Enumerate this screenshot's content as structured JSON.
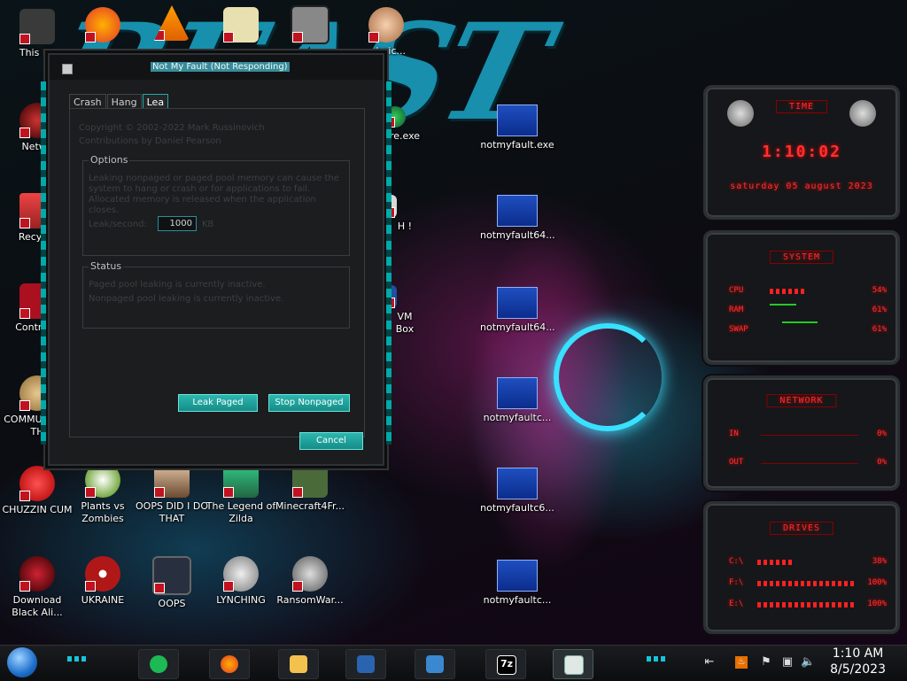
{
  "window": {
    "title": "Not My Fault (Not Responding)",
    "tabs": [
      {
        "label": "Crash"
      },
      {
        "label": "Hang"
      },
      {
        "label": "Lea"
      }
    ],
    "copyright": "Copyright © 2002-2022 Mark Russinovich",
    "contributions": "Contributions by Daniel Pearson",
    "options": {
      "label": "Options",
      "description": "Leaking nonpaged or paged pool memory can cause the system to hang or crash or for applications to fail. Allocated memory is released when the application closes.",
      "leak_label": "Leak/second:",
      "leak_value": "1000",
      "leak_unit": "KB"
    },
    "status": {
      "label": "Status",
      "line1": "Paged pool leaking is currently inactive.",
      "line2": "Nonpaged pool leaking is currently inactive."
    },
    "buttons": {
      "leak_paged": "Leak Paged",
      "stop_nonpaged": "Stop Nonpaged",
      "cancel": "Cancel"
    }
  },
  "desktop_icons": [
    {
      "label": "This PC",
      "color": "#3a3a3a"
    },
    {
      "label": "",
      "color": "#ff7a00"
    },
    {
      "label": "",
      "color": "#ff8c00"
    },
    {
      "label": "",
      "color": "#e8e0b0"
    },
    {
      "label": "",
      "color": "#888888"
    },
    {
      "label": "...hnic...",
      "color": "#e6b08a"
    },
    {
      "label": "Netwo",
      "color": "#5a1020"
    },
    {
      "label": "Recycle",
      "color": "#c03030"
    },
    {
      "label": "Control F",
      "color": "#aa1020"
    },
    {
      "label": "COMMU HATE TH",
      "color": "#c8a060"
    },
    {
      "label": "CHUZZIN CUM",
      "color": "#d02020"
    },
    {
      "label": "Plants vs Zombies",
      "color": "#70a040"
    },
    {
      "label": "OOPS DID I DO THAT",
      "color": "#d0b090"
    },
    {
      "label": "The Legend of Zilda",
      "color": "#40a070"
    },
    {
      "label": "Minecraft4Fr...",
      "color": "#4a6a3a"
    },
    {
      "label": "Download Black Ali...",
      "color": "#600010"
    },
    {
      "label": "UKRAINE",
      "color": "#b01818"
    },
    {
      "label": "OOPS",
      "color": "#283040"
    },
    {
      "label": "LYNCHING",
      "color": "#c8c8c8"
    },
    {
      "label": "RansomWar...",
      "color": "#aaaaaa"
    },
    {
      "label": "re.exe",
      "color": "#2aa040"
    },
    {
      "label": "H !",
      "color": "#d8d8d8"
    },
    {
      "label": "VM Box",
      "color": "#2050a0"
    }
  ],
  "bsod_icons": [
    {
      "label": "notmyfault.exe"
    },
    {
      "label": "notmyfault64..."
    },
    {
      "label": "notmyfault64..."
    },
    {
      "label": "notmyfaultc..."
    },
    {
      "label": "notmyfaultc6..."
    },
    {
      "label": "notmyfaultc..."
    }
  ],
  "widget": {
    "time_title": "TIME",
    "time": "1:10:02",
    "date": "saturday 05 august 2023",
    "system_title": "SYSTEM",
    "cpu_label": "CPU",
    "cpu_value": "54%",
    "cpu_level": 0.54,
    "ram_label": "RAM",
    "ram_value": "61%",
    "ram_level": 0.61,
    "swap_label": "SWAP",
    "swap_value": "61%",
    "swap_level": 0.61,
    "network_title": "NETWORK",
    "in_label": "IN",
    "in_value": "0%",
    "out_label": "OUT",
    "out_value": "0%",
    "drives_title": "DRIVES",
    "drives": [
      {
        "label": "C:\\",
        "value": "38%",
        "level": 0.38
      },
      {
        "label": "F:\\",
        "value": "100%",
        "level": 1.0
      },
      {
        "label": "E:\\",
        "value": "100%",
        "level": 1.0
      }
    ]
  },
  "taskbar": {
    "apps": [
      {
        "name": "spotify",
        "color": "#1db954"
      },
      {
        "name": "firefox",
        "color": "#ff7139"
      },
      {
        "name": "explorer",
        "color": "#f2c14e"
      },
      {
        "name": "virtualbox",
        "color": "#2a64b0"
      },
      {
        "name": "xp",
        "color": "#3a88d0"
      },
      {
        "name": "7zip",
        "color": "#000000"
      },
      {
        "name": "notmyfault",
        "color": "#7ab0a0"
      }
    ],
    "time": "1:10 AM",
    "date": "8/5/2023"
  }
}
